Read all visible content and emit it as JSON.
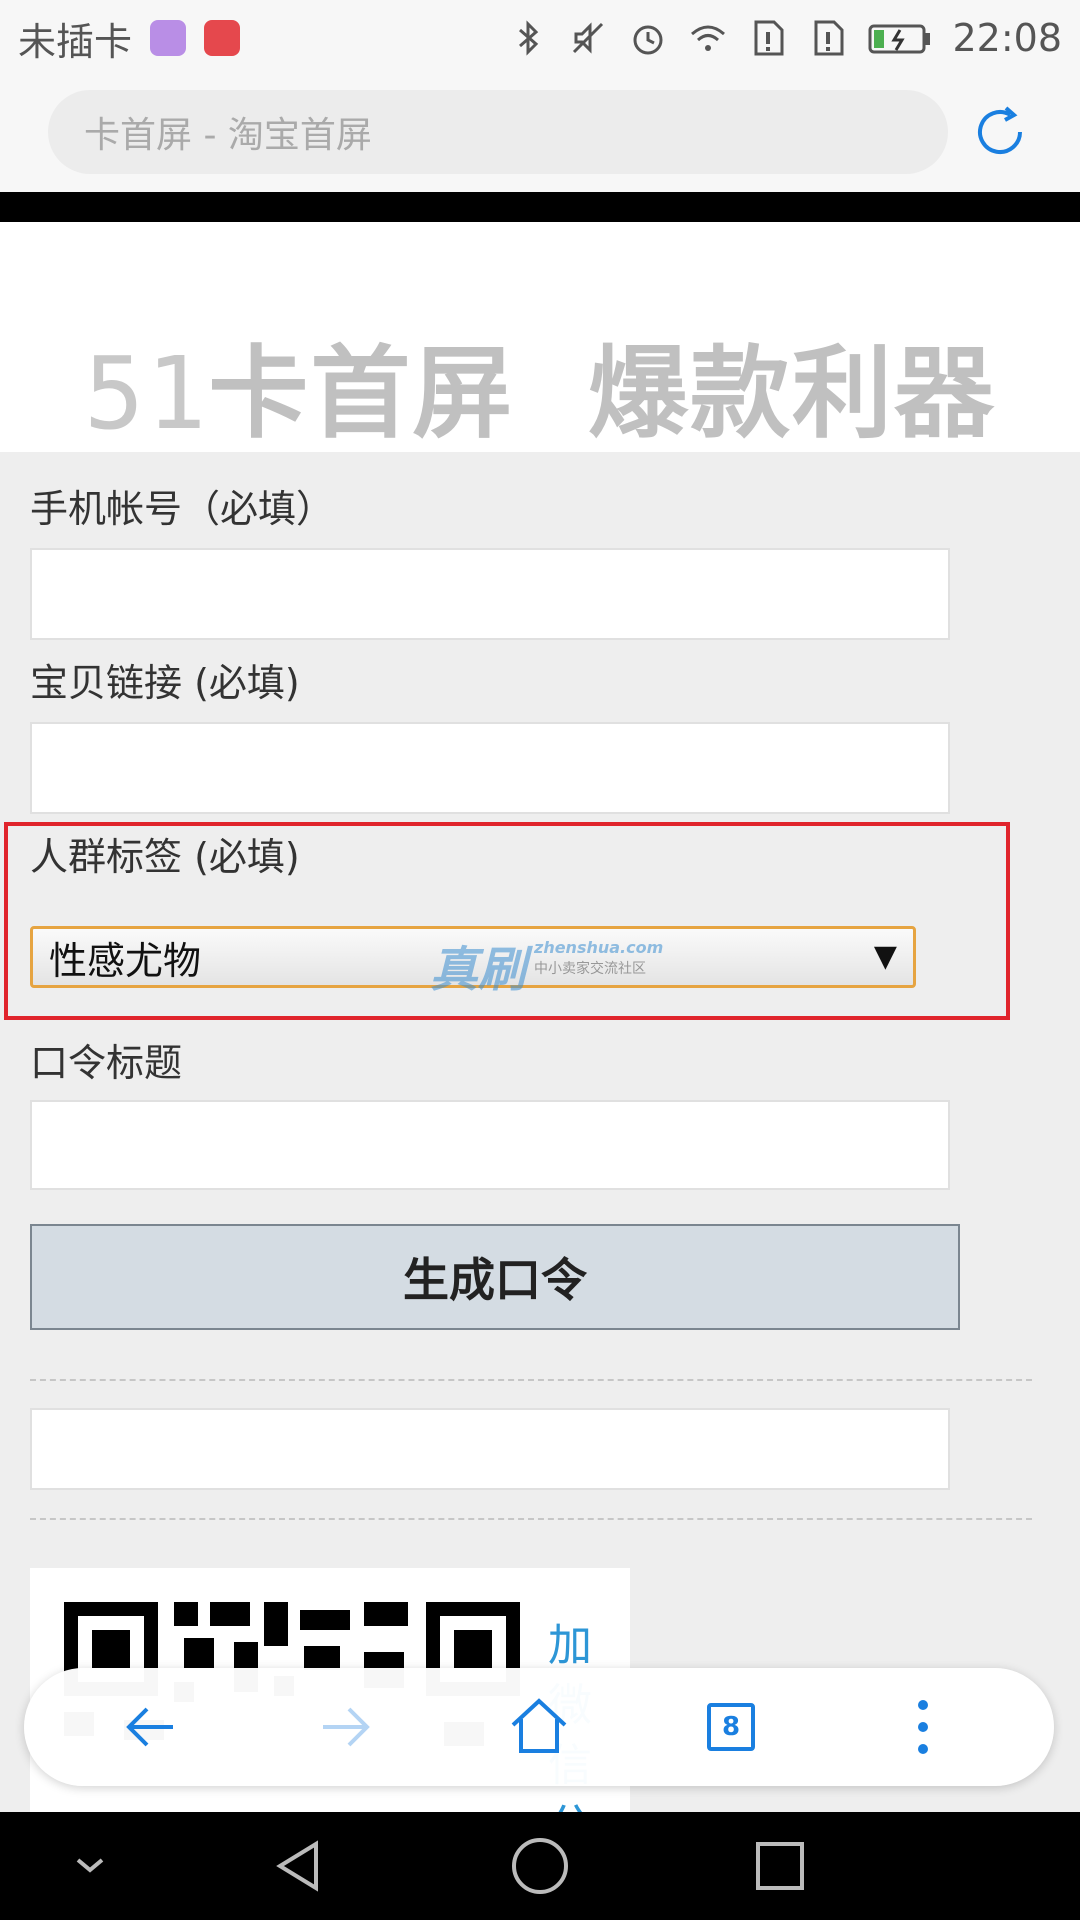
{
  "status_bar": {
    "carrier": "未插卡",
    "time": "22:08",
    "icons": [
      "gallery-app-icon",
      "music-app-icon",
      "bluetooth-icon",
      "mute-icon",
      "alarm-icon",
      "wifi-icon",
      "sim1-alert-icon",
      "sim2-alert-icon",
      "battery-charging-icon"
    ]
  },
  "browser": {
    "url_text": "卡首屏 - 淘宝首屏",
    "tab_count": "8",
    "accent": "#1a7fe0"
  },
  "page": {
    "banner_num": "51",
    "banner_title": "卡首屏  爆款利器",
    "phone_label": "手机帐号（必填）",
    "phone_value": "",
    "link_label": "宝贝链接 (必填)",
    "link_value": "",
    "crowd_label": "人群标签 (必填)",
    "crowd_selected": "性感尤物",
    "token_title_label": "口令标题",
    "token_title_value": "",
    "generate_button": "生成口令",
    "output_value": "",
    "qr_side_text": "加微信公",
    "highlight_color": "#e0242c"
  },
  "watermark": {
    "cn": "真刷",
    "en": "zhenshua.com",
    "sub": "中小卖家交流社区"
  },
  "nav": {
    "icons": [
      "hide-keyboard-icon",
      "back-icon",
      "home-icon",
      "recents-icon"
    ]
  }
}
